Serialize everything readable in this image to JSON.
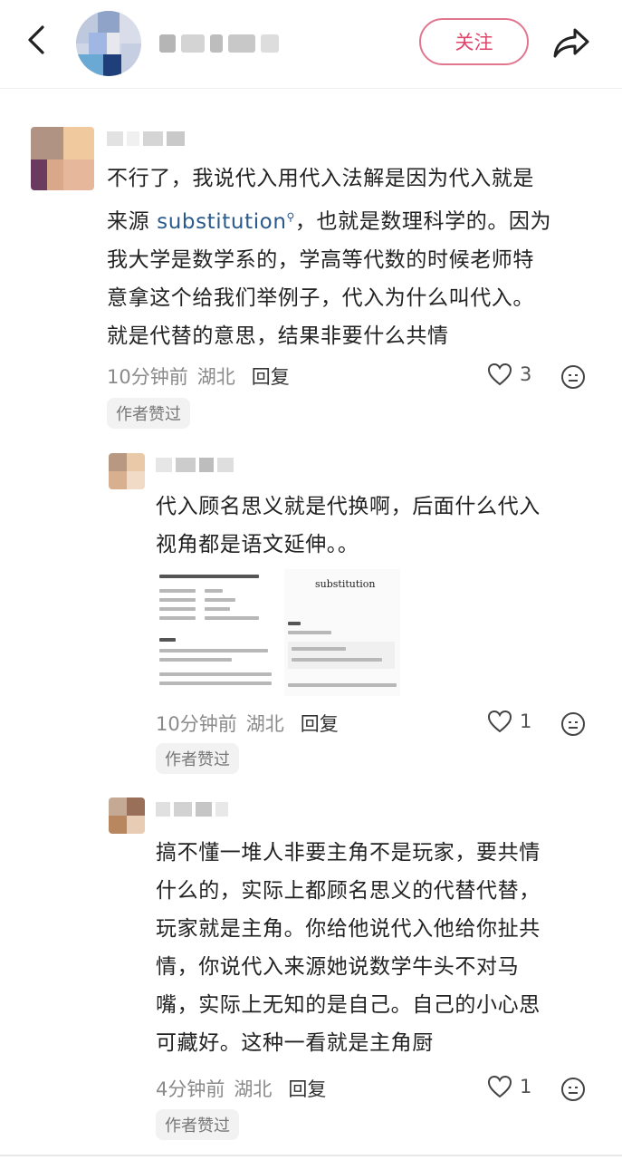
{
  "header": {
    "follow_label": "关注",
    "back_icon": "chevron-left-icon",
    "share_icon": "share-arrow-icon"
  },
  "comments": [
    {
      "text_lines": [
        "不行了，我说代入用代入法解是因为代入就是",
        "来源 ",
        "，也就是数理科学的。因为",
        "我大学是数学系的，学高等代数的时候老师特",
        "意拿这个给我们举例子，代入为什么叫代入。",
        "就是代替的意思，结果非要什么共情"
      ],
      "link_text": "substitution",
      "time": "10分钟前",
      "location": "湖北",
      "reply_label": "回复",
      "likes": "3",
      "badge": "作者赞过"
    },
    {
      "text_lines": [
        "代入顾名思义就是代换啊，后面什么代入",
        "视角都是语文延伸。。"
      ],
      "image_caption": "substitution",
      "time": "10分钟前",
      "location": "湖北",
      "reply_label": "回复",
      "likes": "1",
      "badge": "作者赞过"
    },
    {
      "text_lines": [
        "搞不懂一堆人非要主角不是玩家，要共情",
        "什么的，实际上都顾名思义的代替代替，",
        "玩家就是主角。你给他说代入他给你扯共",
        "情，你说代入来源她说数学牛头不对马",
        "嘴，实际上无知的是自己。自己的小心思",
        "可藏好。这种一看就是主角厨"
      ],
      "time": "4分钟前",
      "location": "湖北",
      "reply_label": "回复",
      "likes": "1",
      "badge": "作者赞过"
    }
  ],
  "colors": {
    "follow": "#e0466b",
    "link": "#2a5a8c",
    "meta": "#8a8a8a"
  }
}
